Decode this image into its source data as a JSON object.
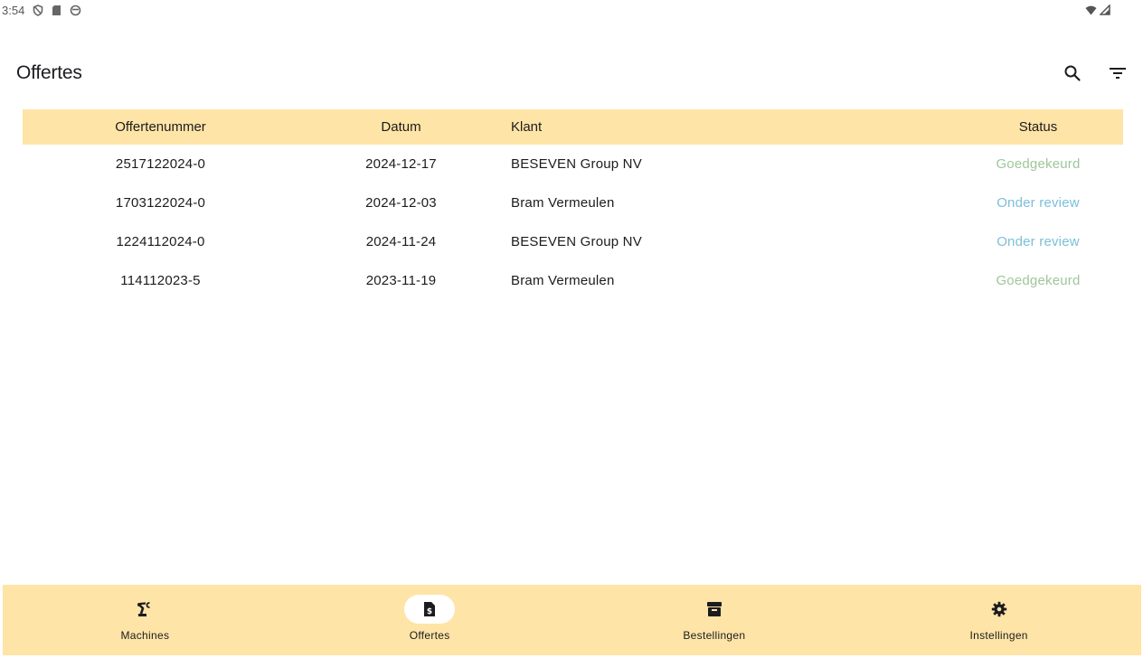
{
  "status_bar": {
    "time": "3:54",
    "icons": [
      "shield-icon",
      "sd-card-icon",
      "clock-icon"
    ],
    "right_icons": [
      "wifi-icon",
      "signal-icon"
    ]
  },
  "app_bar": {
    "title": "Offertes",
    "actions": [
      "search-icon",
      "filter-icon"
    ]
  },
  "table": {
    "columns": [
      "Offertenummer",
      "Datum",
      "Klant",
      "Status"
    ],
    "rows": [
      {
        "number": "2517122024-0",
        "date": "2024-12-17",
        "client": "BESEVEN Group NV",
        "status": "Goedgekeurd"
      },
      {
        "number": "1703122024-0",
        "date": "2024-12-03",
        "client": "Bram Vermeulen",
        "status": "Onder review"
      },
      {
        "number": "1224112024-0",
        "date": "2024-11-24",
        "client": "BESEVEN Group NV",
        "status": "Onder review"
      },
      {
        "number": "114112023-5",
        "date": "2023-11-19",
        "client": "Bram Vermeulen",
        "status": "Goedgekeurd"
      }
    ]
  },
  "nav": {
    "items": [
      {
        "label": "Machines",
        "icon": "robot-arm-icon"
      },
      {
        "label": "Offertes",
        "icon": "invoice-icon",
        "active": true
      },
      {
        "label": "Bestellingen",
        "icon": "archive-box-icon"
      },
      {
        "label": "Instellingen",
        "icon": "gear-icon"
      }
    ]
  },
  "colors": {
    "accent": "#fee4a6",
    "status_approved": "#9ec79a",
    "status_review": "#7bbfd9"
  }
}
